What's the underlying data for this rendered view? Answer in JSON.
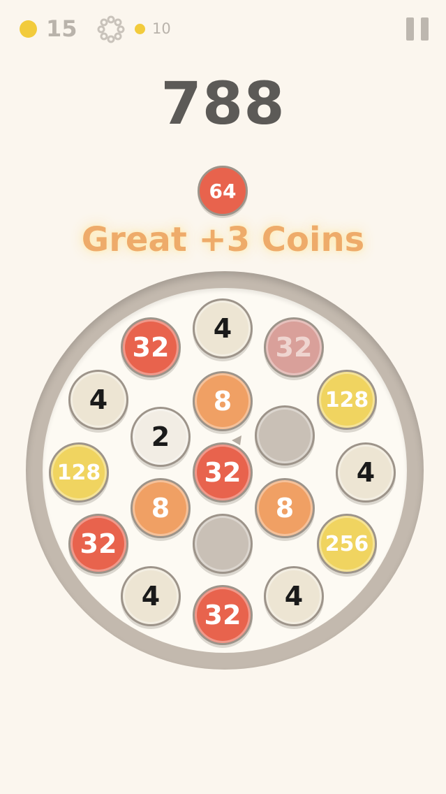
{
  "hud": {
    "coins": "15",
    "gear_cost": "10",
    "colors": {
      "coin": "#f2cb3c",
      "muted": "#b9b3ab"
    }
  },
  "score": "788",
  "next_tile": {
    "value": "64",
    "color": "red"
  },
  "message": "Great +3 Coins",
  "board": {
    "tiles": [
      {
        "id": "top",
        "value": "4",
        "color": "cream"
      },
      {
        "id": "upper-left-1",
        "value": "32",
        "color": "red"
      },
      {
        "id": "upper-right-ghost",
        "value": "32",
        "color": "ghost"
      },
      {
        "id": "left-1",
        "value": "4",
        "color": "cream"
      },
      {
        "id": "center-top",
        "value": "8",
        "color": "orange"
      },
      {
        "id": "right-1",
        "value": "128",
        "color": "yellow"
      },
      {
        "id": "center-left",
        "value": "2",
        "color": "light"
      },
      {
        "id": "center-right-empty",
        "value": "",
        "color": "empty"
      },
      {
        "id": "left-2",
        "value": "128",
        "color": "yellow"
      },
      {
        "id": "center",
        "value": "32",
        "color": "red"
      },
      {
        "id": "right-2",
        "value": "4",
        "color": "cream"
      },
      {
        "id": "lower-left-inner",
        "value": "8",
        "color": "orange"
      },
      {
        "id": "lower-right-inner",
        "value": "8",
        "color": "orange"
      },
      {
        "id": "left-3",
        "value": "32",
        "color": "red"
      },
      {
        "id": "center-bottom-empty",
        "value": "",
        "color": "empty"
      },
      {
        "id": "right-3",
        "value": "256",
        "color": "yellow"
      },
      {
        "id": "bottom-left",
        "value": "4",
        "color": "cream"
      },
      {
        "id": "bottom",
        "value": "32",
        "color": "red"
      },
      {
        "id": "bottom-right",
        "value": "4",
        "color": "cream"
      }
    ]
  }
}
